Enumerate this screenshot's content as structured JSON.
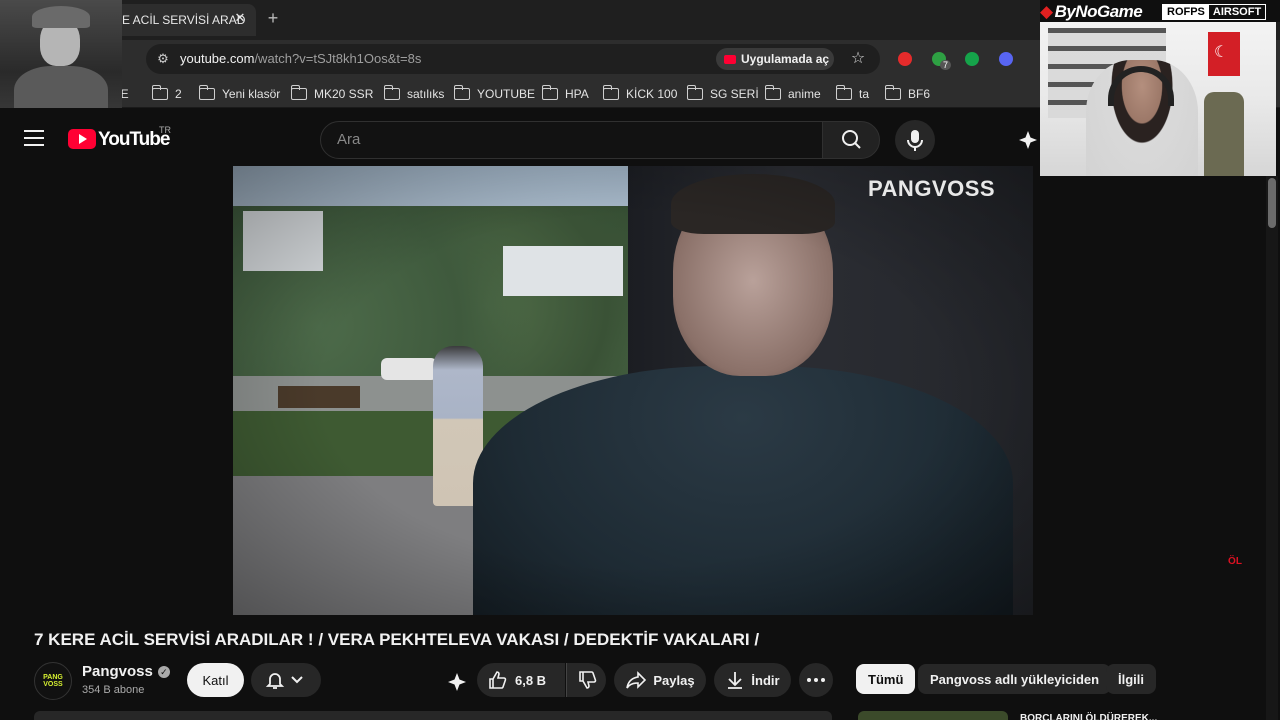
{
  "browser": {
    "tab_title": "E ACİL SERVİSİ ARAD",
    "tab_close": "✕",
    "new_tab": "+",
    "url_host": "youtube.com",
    "url_path": "/watch?v=tSJt8kh1Oos&t=8s",
    "open_in_app": "Uygulamada aç",
    "bookmarks": [
      {
        "label": "NE",
        "folder": false
      },
      {
        "label": "2",
        "folder": true
      },
      {
        "label": "Yeni klasör",
        "folder": true
      },
      {
        "label": "MK20 SSR",
        "folder": true
      },
      {
        "label": "satılıks",
        "folder": true
      },
      {
        "label": "YOUTUBE",
        "folder": true
      },
      {
        "label": "HPA",
        "folder": true
      },
      {
        "label": "KİCK 100",
        "folder": true
      },
      {
        "label": "SG SERİ",
        "folder": true
      },
      {
        "label": "anime",
        "folder": true
      },
      {
        "label": "ta",
        "folder": true
      },
      {
        "label": "BF6",
        "folder": true
      }
    ],
    "extension_badge": "7"
  },
  "youtube": {
    "wordmark": "YouTube",
    "country": "TR",
    "search_placeholder": "Ara"
  },
  "overlay": {
    "sponsor_brand": "ByNoGame",
    "sponsor_tag_a": "ROFPS",
    "sponsor_tag_b": "AIRSOFT"
  },
  "player": {
    "watermark": "PANGVOSS",
    "bug": "ÖL"
  },
  "video": {
    "title": "7 KERE ACİL SERVİSİ ARADILAR ! / VERA PEKHTELEVA VAKASI / DEDEKTİF VAKALARI /",
    "channel_name": "Pangvoss",
    "channel_avatar_top": "PANG",
    "channel_avatar_bottom": "VOSS",
    "subscribers": "354 B abone",
    "join_label": "Katıl",
    "like_count": "6,8 B",
    "share_label": "Paylaş",
    "download_label": "İndir"
  },
  "chips": [
    "Tümü",
    "Pangvoss adlı yükleyiciden",
    "İlgili"
  ],
  "recommendation": {
    "title": "BORÇLARINI ÖLDÜREREK..."
  }
}
